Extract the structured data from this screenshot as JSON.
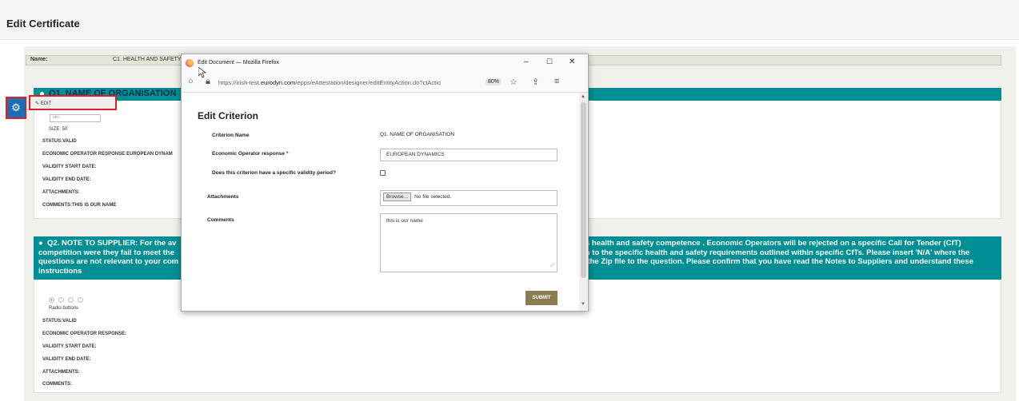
{
  "page": {
    "title": "Edit Certificate"
  },
  "namebar": {
    "label": "Name:",
    "value": "C1. HEALTH AND SAFETY"
  },
  "q1": {
    "header": "Q1. NAME OF ORGANISATION",
    "edit_label": "EDIT",
    "input_placeholder": "abc",
    "size": "SIZE: 50",
    "status": "STATUS:VALID",
    "eo_response": "ECONOMIC OPERATOR RESPONSE:EUROPEAN DYNAM",
    "validity_start": "VALIDITY START DATE:",
    "validity_end": "VALIDITY END DATE:",
    "attachments": "ATTACHMENTS:",
    "comments": "COMMENTS:THIS IS OUR NAME"
  },
  "q2": {
    "header_left": "Q2. NOTE TO SUPPLIER: For the av",
    "header_line2_left": "competition were they fail to meet the",
    "header_line3_left": "questions are not relevant to your com",
    "header_line4_left": "instructions",
    "header_right1": "r's health and safety competence . Economic Operators will be rejected on a specific Call for Tender (CfT)",
    "header_right2": "on to the specific health and safety requirements outlined within specific CfTs. Please insert 'N/A' where the",
    "header_right3": "h the Zip file to the question. Please confirm that you have read the Notes to Suppliers and understand these",
    "radio_label": "Radio buttons",
    "status": "STATUS:VALID",
    "eo_response": "ECONOMIC OPERATOR RESPONSE:",
    "validity_start": "VALIDITY START DATE:",
    "validity_end": "VALIDITY END DATE:",
    "attachments": "ATTACHMENTS:",
    "comments": "COMMENTS:"
  },
  "popup": {
    "window_title": "Edit Document — Mozilla Firefox",
    "url_prefix": "https://irish-test.",
    "url_domain": "eurodyn.com",
    "url_suffix": "/epps/eAttestation/designer/editEntityAction.do?ctActio",
    "zoom": "80%",
    "heading": "Edit Criterion",
    "criterion_name_label": "Criterion Name",
    "criterion_name_value": "Q1. NAME OF ORGANISATION",
    "eo_response_label": "Economic Operator response",
    "eo_response_value": "EUROPEAN DYNAMICS",
    "validity_question": "Does this criterion have a specific validity period?",
    "attachments_label": "Attachments",
    "browse_label": "Browse...",
    "no_file": "No file selected.",
    "comments_label": "Comments",
    "comments_value": "this is our name",
    "submit_label": "SUBMIT"
  }
}
